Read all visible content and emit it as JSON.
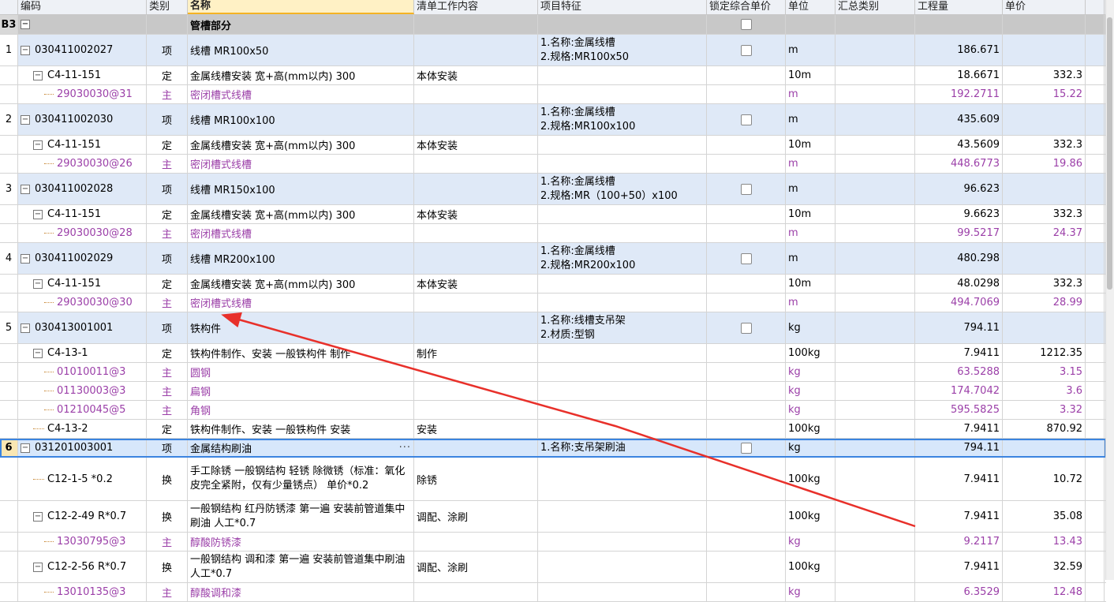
{
  "columns": [
    "编码",
    "类别",
    "名称",
    "清单工作内容",
    "项目特征",
    "锁定综合单价",
    "单位",
    "汇总类别",
    "工程量",
    "单价"
  ],
  "group": {
    "index": "B3",
    "name": "管槽部分"
  },
  "rows": [
    {
      "idx": "1",
      "code": "030411002027",
      "type": "项",
      "name": "线槽  MR100x50",
      "feature1": "1.名称:金属线槽",
      "feature2": "2.规格:MR100x50",
      "unit": "m",
      "qty": "186.671",
      "price": ""
    },
    {
      "code": "C4-11-151",
      "type": "定",
      "name": "金属线槽安装  宽+高(mm以内)  300",
      "work": "本体安装",
      "unit": "10m",
      "qty": "18.6671",
      "price": "332.3"
    },
    {
      "code": "29030030@31",
      "type": "主",
      "name": "密闭槽式线槽",
      "unit": "m",
      "qty": "192.2711",
      "price": "15.22"
    },
    {
      "idx": "2",
      "code": "030411002030",
      "type": "项",
      "name": "线槽  MR100x100",
      "feature1": "1.名称:金属线槽",
      "feature2": "2.规格:MR100x100",
      "unit": "m",
      "qty": "435.609",
      "price": ""
    },
    {
      "code": "C4-11-151",
      "type": "定",
      "name": "金属线槽安装  宽+高(mm以内)  300",
      "work": "本体安装",
      "unit": "10m",
      "qty": "43.5609",
      "price": "332.3"
    },
    {
      "code": "29030030@26",
      "type": "主",
      "name": "密闭槽式线槽",
      "unit": "m",
      "qty": "448.6773",
      "price": "19.86"
    },
    {
      "idx": "3",
      "code": "030411002028",
      "type": "项",
      "name": "线槽  MR150x100",
      "feature1": "1.名称:金属线槽",
      "feature2": "2.规格:MR（100+50）x100",
      "unit": "m",
      "qty": "96.623",
      "price": ""
    },
    {
      "code": "C4-11-151",
      "type": "定",
      "name": "金属线槽安装  宽+高(mm以内)  300",
      "work": "本体安装",
      "unit": "10m",
      "qty": "9.6623",
      "price": "332.3"
    },
    {
      "code": "29030030@28",
      "type": "主",
      "name": "密闭槽式线槽",
      "unit": "m",
      "qty": "99.5217",
      "price": "24.37"
    },
    {
      "idx": "4",
      "code": "030411002029",
      "type": "项",
      "name": "线槽  MR200x100",
      "feature1": "1.名称:金属线槽",
      "feature2": "2.规格:MR200x100",
      "unit": "m",
      "qty": "480.298",
      "price": ""
    },
    {
      "code": "C4-11-151",
      "type": "定",
      "name": "金属线槽安装  宽+高(mm以内)  300",
      "work": "本体安装",
      "unit": "10m",
      "qty": "48.0298",
      "price": "332.3"
    },
    {
      "code": "29030030@30",
      "type": "主",
      "name": "密闭槽式线槽",
      "unit": "m",
      "qty": "494.7069",
      "price": "28.99"
    },
    {
      "idx": "5",
      "code": "030413001001",
      "type": "项",
      "name": "铁构件",
      "feature1": "1.名称:线槽支吊架",
      "feature2": "2.材质:型钢",
      "unit": "kg",
      "qty": "794.11",
      "price": ""
    },
    {
      "code": "C4-13-1",
      "type": "定",
      "name": "铁构件制作、安装  一般铁构件  制作",
      "work": "制作",
      "unit": "100kg",
      "qty": "7.9411",
      "price": "1212.35"
    },
    {
      "code": "01010011@3",
      "type": "主",
      "name": "圆钢",
      "unit": "kg",
      "qty": "63.5288",
      "price": "3.15"
    },
    {
      "code": "01130003@3",
      "type": "主",
      "name": "扁钢",
      "unit": "kg",
      "qty": "174.7042",
      "price": "3.6"
    },
    {
      "code": "01210045@5",
      "type": "主",
      "name": "角钢",
      "unit": "kg",
      "qty": "595.5825",
      "price": "3.32"
    },
    {
      "code": "C4-13-2",
      "type": "定",
      "name": "铁构件制作、安装  一般铁构件  安装",
      "work": "安装",
      "unit": "100kg",
      "qty": "7.9411",
      "price": "870.92"
    },
    {
      "idx": "6",
      "code": "031201003001",
      "type": "项",
      "name": "金属结构刷油",
      "feature1": "1.名称:支吊架刷油",
      "unit": "kg",
      "qty": "794.11",
      "price": ""
    },
    {
      "code": "C12-1-5  *0.2",
      "type": "换",
      "name": "手工除锈  一般钢结构  轻锈  除微锈（标准：氧化皮完全紧附，仅有少量锈点）  单价*0.2",
      "work": "除锈",
      "unit": "100kg",
      "qty": "7.9411",
      "price": "10.72"
    },
    {
      "code": "C12-2-49  R*0.7",
      "type": "换",
      "name": "一般钢结构  红丹防锈漆  第一遍  安装前管道集中刷油  人工*0.7",
      "work": "调配、涂刷",
      "unit": "100kg",
      "qty": "7.9411",
      "price": "35.08"
    },
    {
      "code": "13030795@3",
      "type": "主",
      "name": "醇酸防锈漆",
      "unit": "kg",
      "qty": "9.2117",
      "price": "13.43"
    },
    {
      "code": "C12-2-56  R*0.7",
      "type": "换",
      "name": "一般钢结构  调和漆  第一遍  安装前管道集中刷油  人工*0.7",
      "work": "调配、涂刷",
      "unit": "100kg",
      "qty": "7.9411",
      "price": "32.59"
    },
    {
      "code": "13010135@3",
      "type": "主",
      "name": "醇酸调和漆",
      "unit": "kg",
      "qty": "6.3529",
      "price": "12.48"
    }
  ],
  "colors": {
    "header": "#eef1f6",
    "item_row": "#dfe9f7",
    "selected_border": "#3b84e0",
    "material_text": "#9b3fa8",
    "arrow": "#e8302a"
  }
}
